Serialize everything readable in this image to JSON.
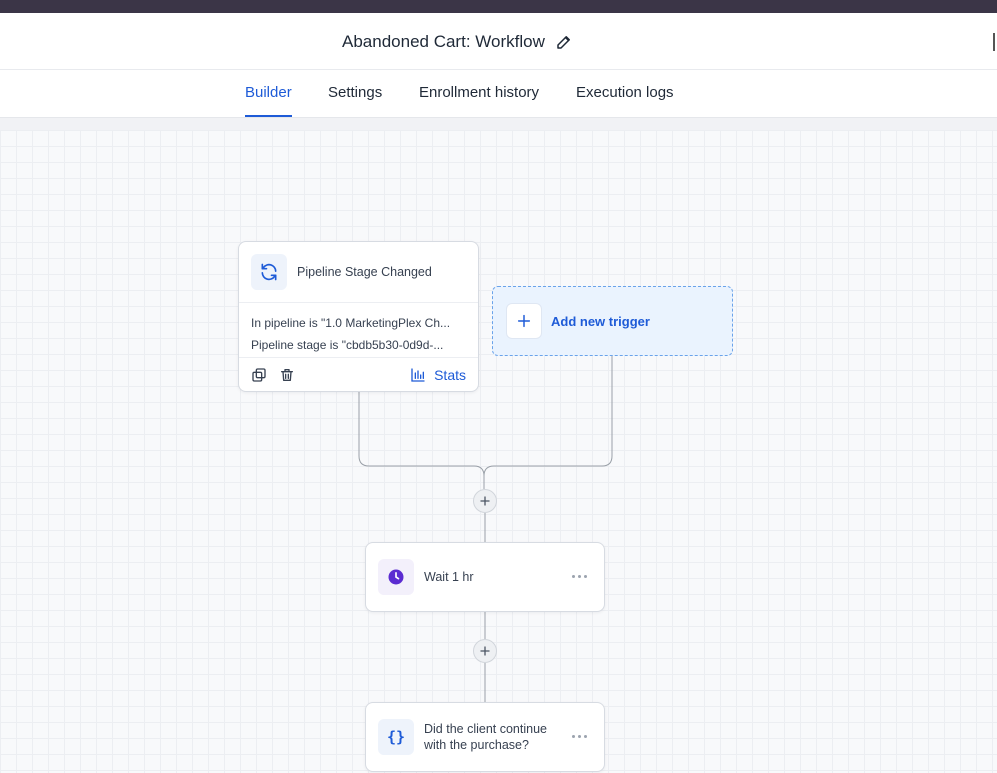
{
  "header": {
    "title": "Abandoned Cart: Workflow",
    "edit_icon": "pencil-icon"
  },
  "tabs": [
    {
      "label": "Builder",
      "active": true
    },
    {
      "label": "Settings",
      "active": false
    },
    {
      "label": "Enrollment history",
      "active": false
    },
    {
      "label": "Execution logs",
      "active": false
    }
  ],
  "trigger": {
    "title": "Pipeline Stage Changed",
    "icon": "refresh-icon",
    "conditions": [
      "In pipeline is \"1.0 MarketingPlex Ch...",
      "Pipeline stage is \"cbdb5b30-0d9d-..."
    ],
    "stats_label": "Stats"
  },
  "add_trigger": {
    "label": "Add new trigger"
  },
  "actions": [
    {
      "title": "Wait 1 hr",
      "icon": "clock-icon"
    },
    {
      "title_line1": "Did the client continue",
      "title_line2": "with the purchase?",
      "icon": "curly-braces-icon"
    }
  ],
  "colors": {
    "accent": "#1e5bd7",
    "topbar": "#3b3547",
    "trigger_dashed_bg": "#eaf3fe",
    "clock_purple": "#5b2bd1"
  }
}
